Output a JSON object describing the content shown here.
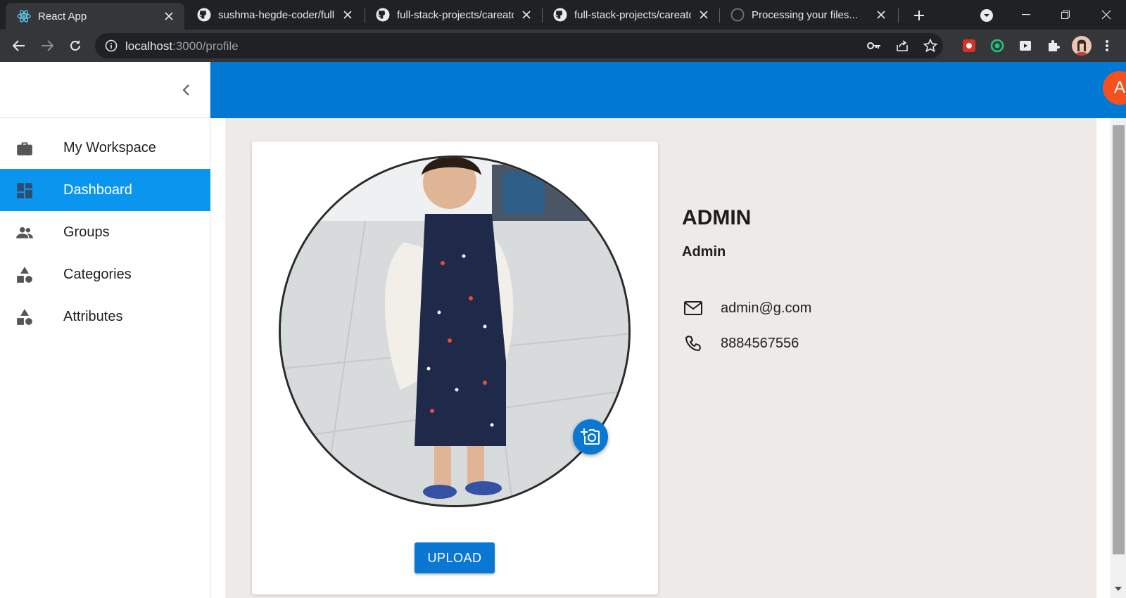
{
  "browser": {
    "tabs": [
      {
        "title": "React App",
        "icon": "react-icon",
        "active": true
      },
      {
        "title": "sushma-hegde-coder/full-",
        "icon": "github-icon",
        "active": false
      },
      {
        "title": "full-stack-projects/careato",
        "icon": "github-icon",
        "active": false
      },
      {
        "title": "full-stack-projects/careato",
        "icon": "github-icon",
        "active": false
      },
      {
        "title": "Processing your files...",
        "icon": "github-icon",
        "active": false
      }
    ],
    "url_host": "localhost",
    "url_path": ":3000/profile"
  },
  "sidebar": {
    "items": [
      {
        "label": "My Workspace",
        "icon": "briefcase-icon",
        "active": false
      },
      {
        "label": "Dashboard",
        "icon": "dashboard-icon",
        "active": true
      },
      {
        "label": "Groups",
        "icon": "people-icon",
        "active": false
      },
      {
        "label": "Categories",
        "icon": "category-icon",
        "active": false
      },
      {
        "label": "Attributes",
        "icon": "category-icon",
        "active": false
      }
    ]
  },
  "appbar": {
    "avatar_letter": "A",
    "color": "#0078d4"
  },
  "profile": {
    "name": "ADMIN",
    "role": "Admin",
    "email": "admin@g.com",
    "phone": "8884567556",
    "upload_label": "UPLOAD"
  },
  "colors": {
    "accent": "#0a78d2",
    "active_nav": "#0a96ef",
    "avatar": "#f4511e"
  }
}
